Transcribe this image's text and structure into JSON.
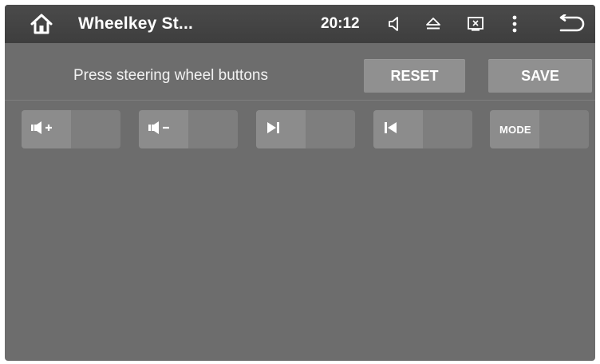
{
  "statusbar": {
    "title": "Wheelkey St...",
    "time": "20:12",
    "icons": [
      "home-icon",
      "volume-icon",
      "eject-icon",
      "screen-close-icon",
      "more-vert-icon",
      "back-icon"
    ]
  },
  "instruction": "Press steering wheel buttons",
  "actions": {
    "reset_label": "RESET",
    "save_label": "SAVE"
  },
  "keys": [
    {
      "icon": "volume-up-icon"
    },
    {
      "icon": "volume-down-icon"
    },
    {
      "icon": "next-track-icon"
    },
    {
      "icon": "previous-track-icon"
    },
    {
      "label": "MODE"
    }
  ],
  "colors": {
    "background": "#6d6d6d",
    "statusbar": "#424242",
    "button": "#909090",
    "key_left": "#8c8c8c",
    "key_right": "#7e7e7e",
    "text": "#ffffff"
  }
}
